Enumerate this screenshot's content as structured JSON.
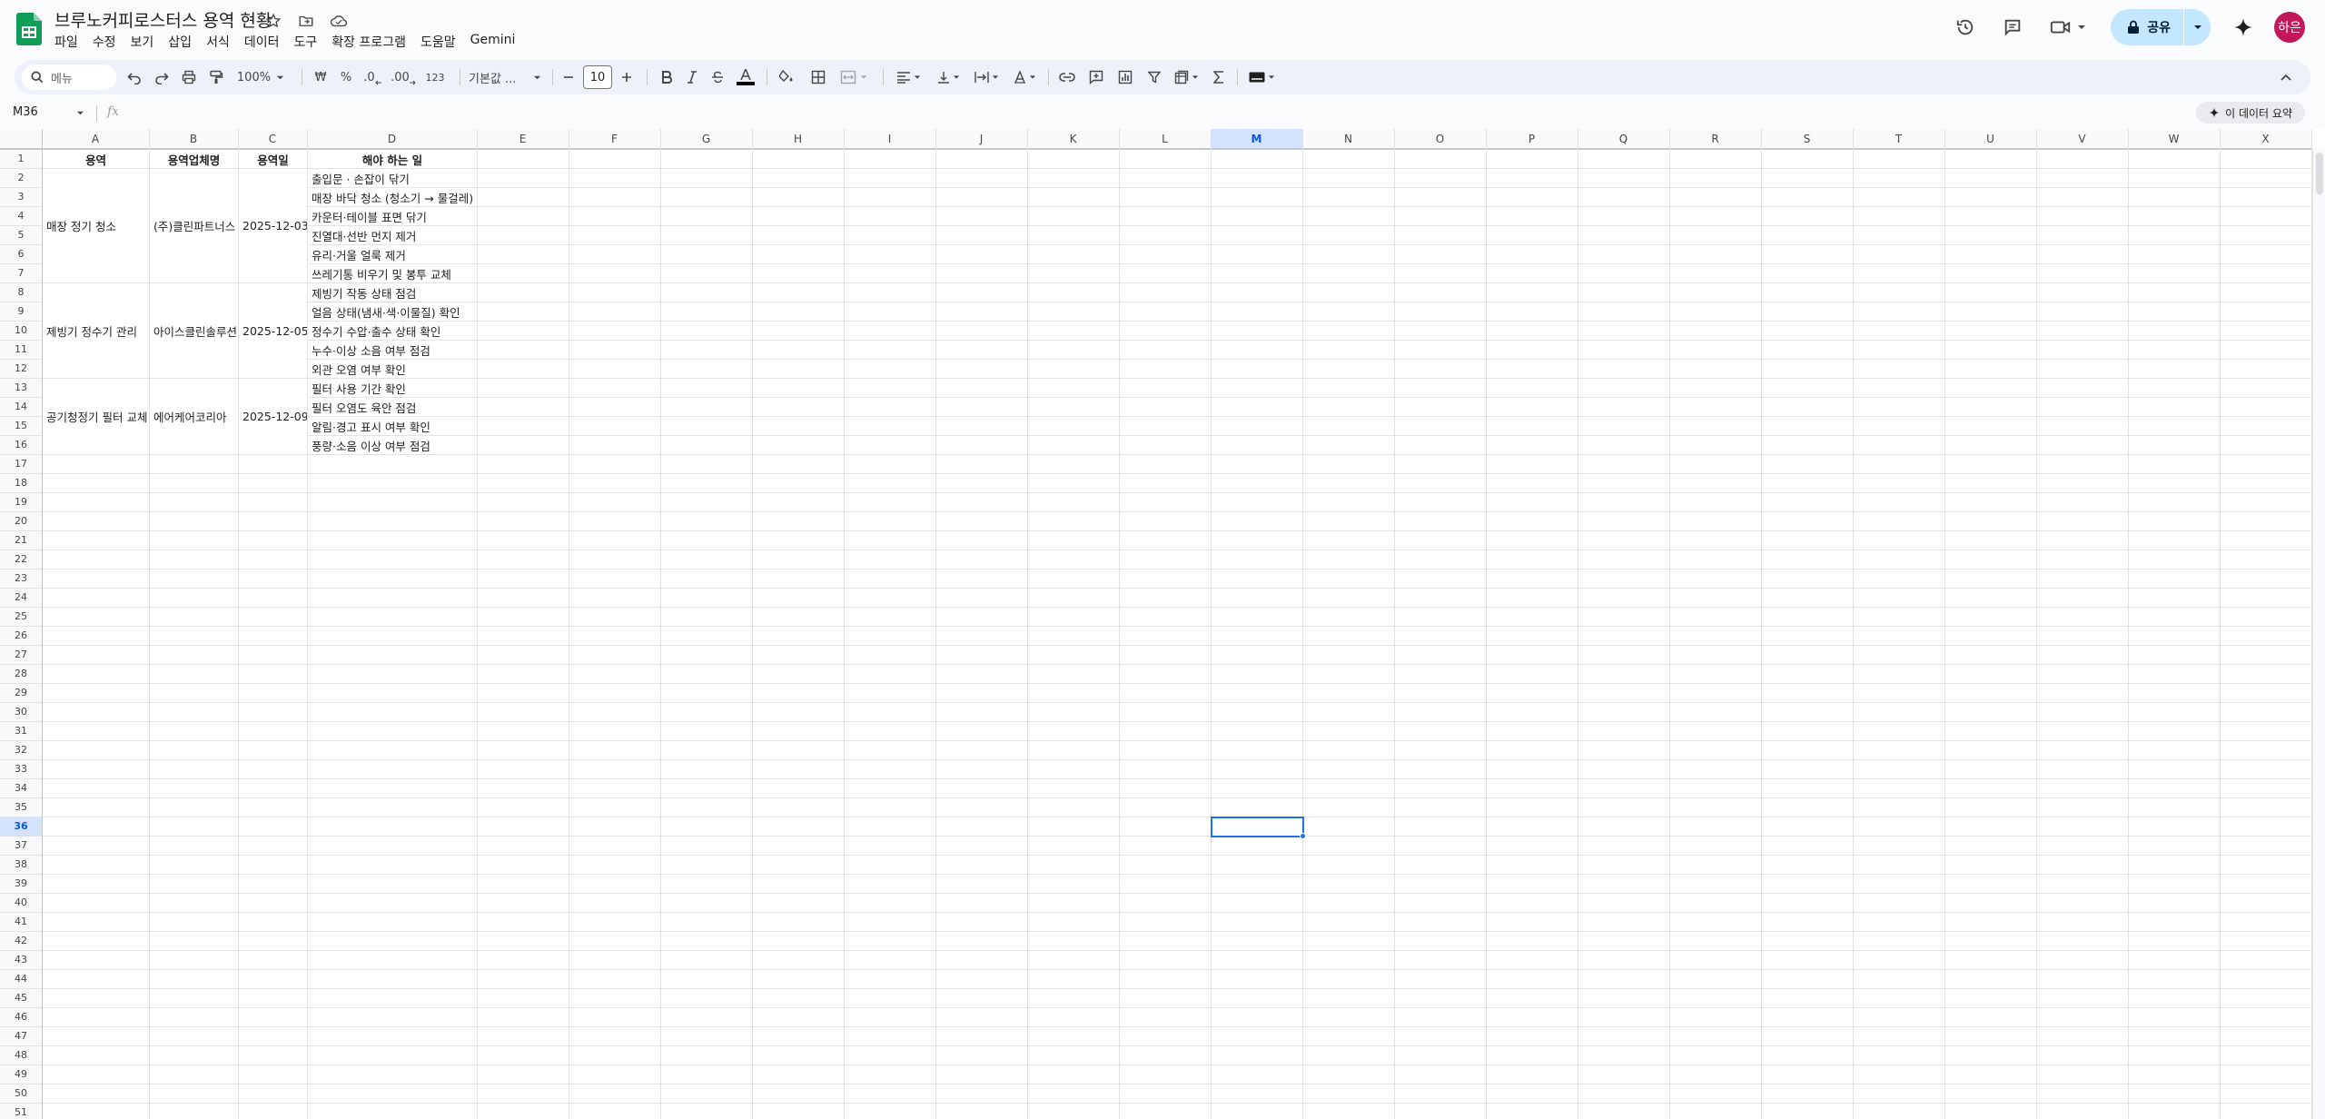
{
  "doc": {
    "title": "브루노커피로스터스 용역 현황"
  },
  "menu": [
    "파일",
    "수정",
    "보기",
    "삽입",
    "서식",
    "데이터",
    "도구",
    "확장 프로그램",
    "도움말",
    "Gemini"
  ],
  "header": {
    "share_label": "공유",
    "avatar_text": "하은"
  },
  "toolbar": {
    "search_label": "메뉴",
    "zoom": "100%",
    "currency": "₩",
    "percent": "%",
    "dec_decrease": ".0",
    "dec_increase": ".00",
    "number_format": "123",
    "font": "기본값 ...",
    "font_size": "10"
  },
  "formula_bar": {
    "cell_ref": "M36",
    "fx": "fx",
    "summary_label": "이 데이터 요약"
  },
  "grid": {
    "columns": [
      "A",
      "B",
      "C",
      "D",
      "E",
      "F",
      "G",
      "H",
      "I",
      "J",
      "K",
      "L",
      "M",
      "N",
      "O",
      "P",
      "Q",
      "R",
      "S",
      "T",
      "U",
      "V",
      "W",
      "X"
    ],
    "selected_column": "M",
    "selected_row": 36,
    "row_count": 51,
    "headers": [
      "용역",
      "용역업체명",
      "용역일",
      "해야 하는 일"
    ],
    "groups": [
      {
        "service": "매장 정기 청소",
        "vendor": "(주)클린파트너스",
        "date": "2025-12-03",
        "tasks": [
          "출입문 · 손잡이 닦기",
          "매장 바닥 청소 (청소기 → 물걸레)",
          "카운터·테이블 표면 닦기",
          "진열대·선반 먼지 제거",
          "유리·거울 얼룩 제거",
          "쓰레기통 비우기 및 봉투 교체"
        ]
      },
      {
        "service": "제빙기 정수기 관리",
        "vendor": "아이스클린솔루션",
        "date": "2025-12-05",
        "tasks": [
          "제빙기 작동 상태 점검",
          "얼음 상태(냄새·색·이물질) 확인",
          "정수기 수압·출수 상태 확인",
          "누수·이상 소음 여부 점검",
          "외관 오염 여부 확인"
        ]
      },
      {
        "service": "공기청정기 필터 교체",
        "vendor": "에어케어코리아",
        "date": "2025-12-09",
        "tasks": [
          "필터 사용 기간 확인",
          "필터 오염도 육안 점검",
          "알림·경고 표시 여부 확인",
          "풍량·소음 이상 여부 점검"
        ]
      }
    ]
  }
}
